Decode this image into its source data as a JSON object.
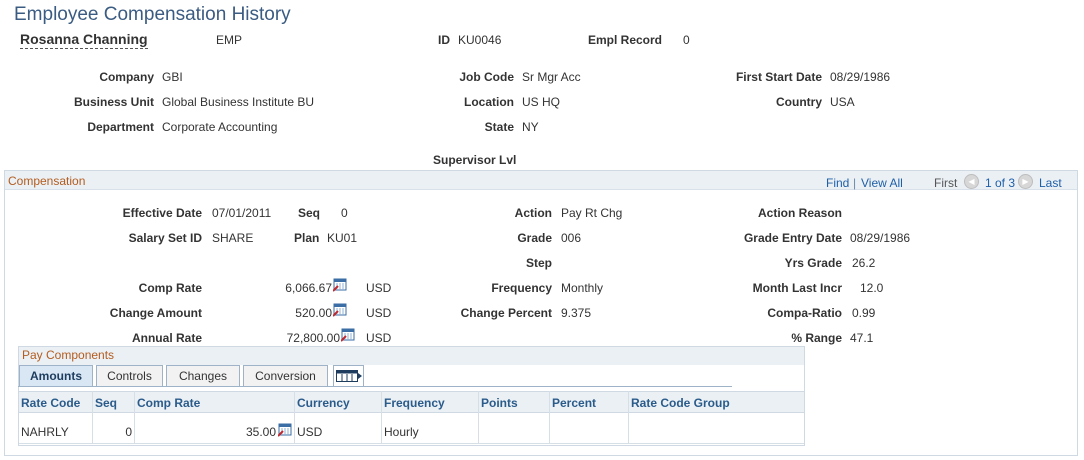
{
  "page": {
    "title": "Employee Compensation History"
  },
  "employee": {
    "name": "Rosanna Channing",
    "type": "EMP",
    "id_label": "ID",
    "id": "KU0046",
    "empl_record_label": "Empl Record",
    "empl_record": "0"
  },
  "job": {
    "company_label": "Company",
    "company": "GBI",
    "business_unit_label": "Business Unit",
    "business_unit": "Global Business Institute BU",
    "department_label": "Department",
    "department": "Corporate Accounting",
    "job_code_label": "Job Code",
    "job_code": "Sr Mgr Acc",
    "location_label": "Location",
    "location": "US HQ",
    "state_label": "State",
    "state": "NY",
    "first_start_label": "First Start Date",
    "first_start": "08/29/1986",
    "country_label": "Country",
    "country": "USA",
    "supervisor_label": "Supervisor Lvl"
  },
  "compensation": {
    "title": "Compensation",
    "nav": {
      "find": "Find",
      "sep": "|",
      "view_all": "View All",
      "first": "First",
      "count": "1 of 3",
      "last": "Last"
    },
    "effective_date_label": "Effective Date",
    "effective_date": "07/01/2011",
    "seq_label": "Seq",
    "seq": "0",
    "salary_set_label": "Salary Set ID",
    "salary_set": "SHARE",
    "plan_label": "Plan",
    "plan": "KU01",
    "action_label": "Action",
    "action": "Pay Rt Chg",
    "grade_label": "Grade",
    "grade": "006",
    "step_label": "Step",
    "frequency_label": "Frequency",
    "frequency": "Monthly",
    "change_percent_label": "Change Percent",
    "change_percent": "9.375",
    "action_reason_label": "Action Reason",
    "grade_entry_label": "Grade Entry Date",
    "grade_entry": "08/29/1986",
    "yrs_grade_label": "Yrs Grade",
    "yrs_grade": "26.2",
    "month_last_label": "Month Last Incr",
    "month_last": "12.0",
    "compa_ratio_label": "Compa-Ratio",
    "compa_ratio": "0.99",
    "range_label": "% Range",
    "range": "47.1",
    "comp_rate_label": "Comp Rate",
    "comp_rate": "6,066.67",
    "comp_rate_cur": "USD",
    "change_amount_label": "Change Amount",
    "change_amount": "520.00",
    "change_amount_cur": "USD",
    "annual_rate_label": "Annual Rate",
    "annual_rate": "72,800.00",
    "annual_rate_cur": "USD"
  },
  "pay_components": {
    "title": "Pay Components",
    "tabs": [
      "Amounts",
      "Controls",
      "Changes",
      "Conversion"
    ],
    "columns": [
      "Rate Code",
      "Seq",
      "Comp Rate",
      "Currency",
      "Frequency",
      "Points",
      "Percent",
      "Rate Code Group"
    ],
    "rows": [
      {
        "rate_code": "NAHRLY",
        "seq": "0",
        "comp_rate": "35.00",
        "currency": "USD",
        "frequency": "Hourly",
        "points": "",
        "percent": "",
        "group": ""
      }
    ]
  },
  "colors": {
    "title": "#3b5c82",
    "section_title": "#b35c1e",
    "link": "#1f5fa8",
    "header_bg": "#ebf0f5"
  },
  "icons": [
    "calendar-calculator-icon",
    "prev-arrow-icon",
    "next-arrow-icon",
    "show-all-columns-icon"
  ]
}
